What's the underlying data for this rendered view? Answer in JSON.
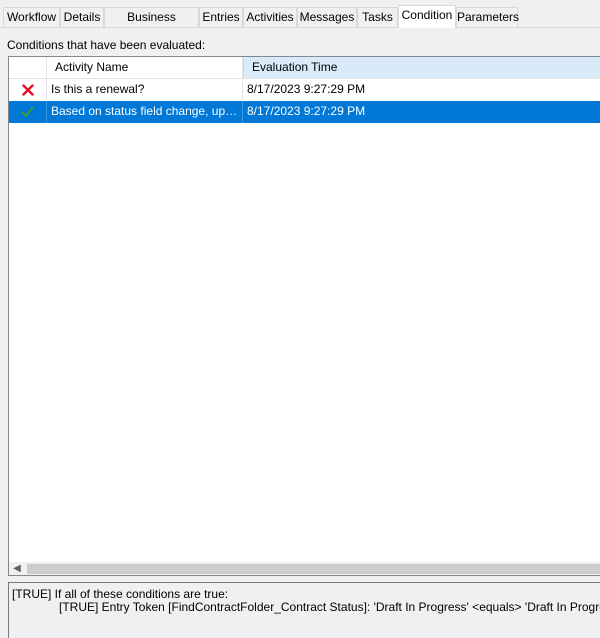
{
  "tabs": [
    {
      "label": "Workflow"
    },
    {
      "label": "Details"
    },
    {
      "label": "Business Process"
    },
    {
      "label": "Entries"
    },
    {
      "label": "Activities"
    },
    {
      "label": "Messages"
    },
    {
      "label": "Tasks"
    },
    {
      "label": "Condition",
      "active": true
    },
    {
      "label": "Parameters"
    }
  ],
  "section_label": "Conditions that have been evaluated:",
  "table": {
    "columns": [
      "",
      "Activity Name",
      "Evaluation Time"
    ],
    "sorted_column": "Evaluation Time",
    "rows": [
      {
        "status_icon": "red-x-icon",
        "activity_name": "Is this a renewal?",
        "evaluation_time": "8/17/2023 9:27:29 PM",
        "selected": false
      },
      {
        "status_icon": "green-check-icon",
        "activity_name": "Based on status field change, update ...",
        "evaluation_time": "8/17/2023 9:27:29 PM",
        "selected": true
      }
    ]
  },
  "details": {
    "line1": "[TRUE] If all of these conditions are true:",
    "line2": "[TRUE] Entry Token [FindContractFolder_Contract Status]:  'Draft In Progress' <equals> 'Draft In Progress'"
  },
  "colors": {
    "selection": "#0078d7",
    "sorted_header": "#d9ebf9",
    "false_icon": "#e81123",
    "true_icon": "#3a9e2f"
  }
}
